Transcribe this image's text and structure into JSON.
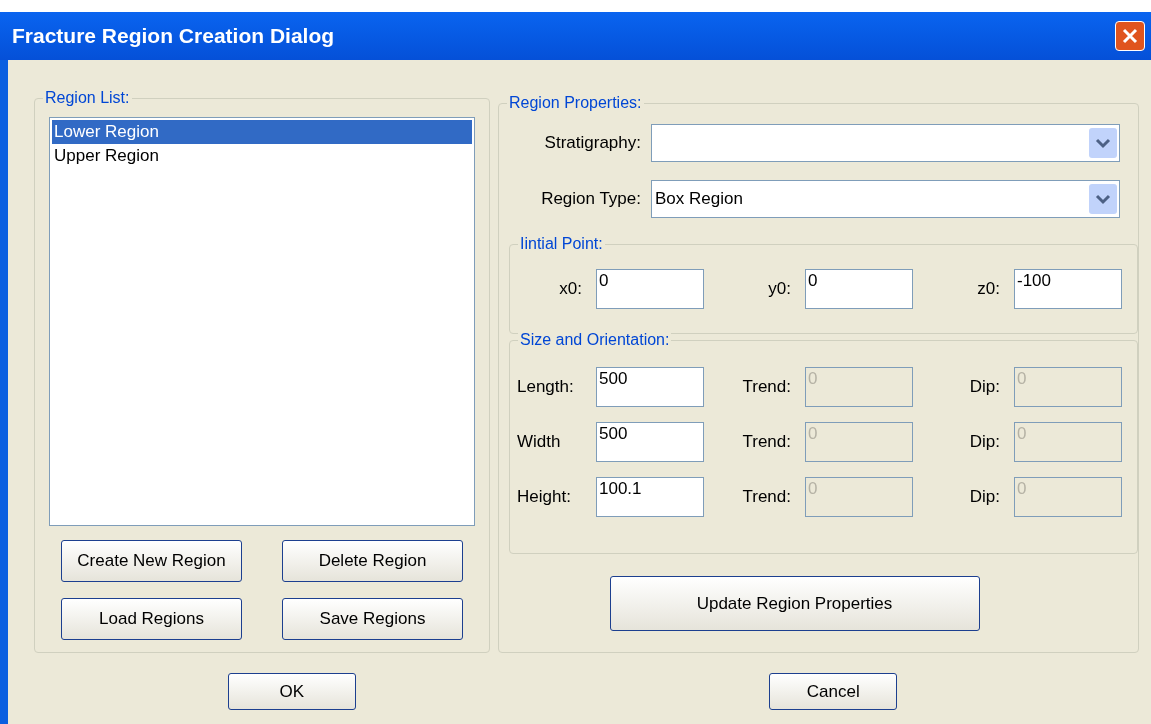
{
  "window": {
    "title": "Fracture Region Creation Dialog"
  },
  "region_list": {
    "legend": "Region List:",
    "items": [
      {
        "label": "Lower Region",
        "selected": true
      },
      {
        "label": "Upper Region",
        "selected": false
      }
    ],
    "buttons": [
      "Create New Region",
      "Delete Region",
      "Load Regions",
      "Save Regions"
    ]
  },
  "region_properties": {
    "legend": "Region Properties:",
    "dropdowns": [
      {
        "label": "Stratigraphy:"
      },
      {
        "label": "Region Type:",
        "value": "Box Region"
      }
    ],
    "initial_point": {
      "legend": "Iintial Point:",
      "fields": [
        {
          "label": "x0:",
          "value": "0"
        },
        {
          "label": "y0:",
          "value": "0"
        },
        {
          "label": "z0:",
          "value": "-100"
        }
      ]
    },
    "size_and_orientation": {
      "legend": "Size and Orientation:",
      "rows": [
        [
          {
            "label": "Length:",
            "value": "500",
            "disabled": false
          },
          {
            "label": "Trend:",
            "value": "0",
            "disabled": true
          },
          {
            "label": "Dip:",
            "value": "0",
            "disabled": true
          }
        ],
        [
          {
            "label": "Width",
            "value": "500",
            "disabled": false
          },
          {
            "label": "Trend:",
            "value": "0",
            "disabled": true
          },
          {
            "label": "Dip:",
            "value": "0",
            "disabled": true
          }
        ],
        [
          {
            "label": "Height:",
            "value": "100.1",
            "disabled": false
          },
          {
            "label": "Trend:",
            "value": "0",
            "disabled": true
          },
          {
            "label": "Dip:",
            "value": "0",
            "disabled": true
          }
        ]
      ]
    },
    "update_button": "Update Region Properties"
  },
  "footer_buttons": [
    "OK",
    "Cancel"
  ]
}
